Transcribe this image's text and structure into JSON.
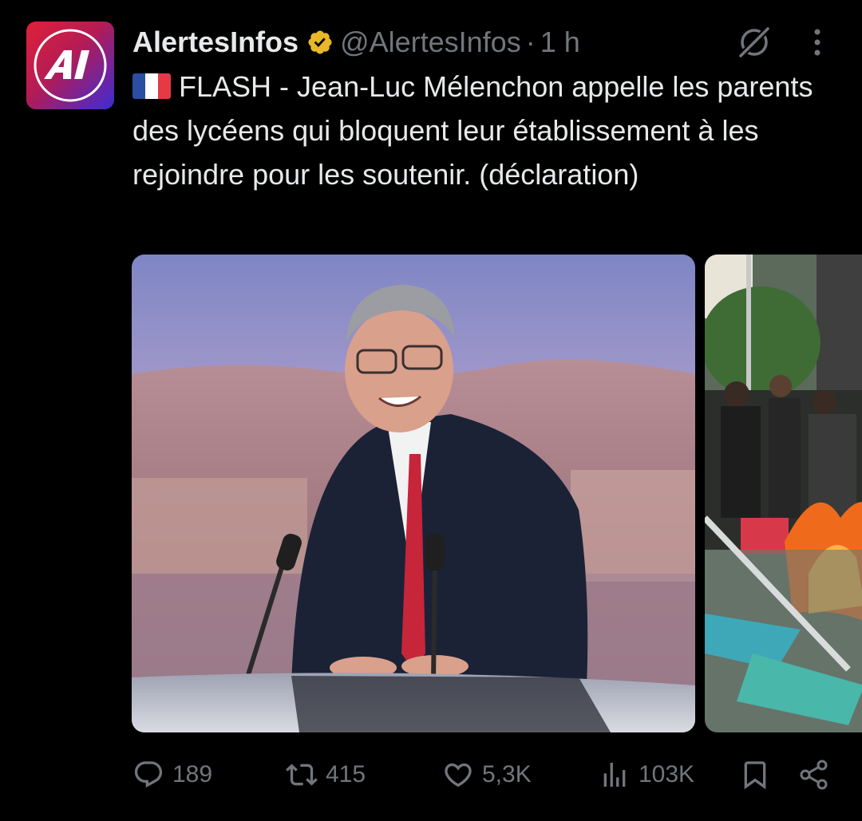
{
  "tweet": {
    "display_name": "AlertesInfos",
    "handle": "@AlertesInfos",
    "separator": "·",
    "time": "1 h",
    "avatar_text": "AI",
    "text": "FLASH - Jean-Luc Mélenchon appelle les parents des lycéens qui bloquent leur établissement à les rejoindre pour les soutenir. (déclaration)",
    "flag_icon": "france-flag-icon",
    "verified_icon": "gold-verified-badge-icon"
  },
  "actions": {
    "replies": "189",
    "reposts": "415",
    "likes": "5,3K",
    "views": "103K"
  },
  "icons": [
    "grok-icon",
    "more-dots-icon",
    "reply-icon",
    "repost-icon",
    "like-icon",
    "views-icon",
    "bookmark-icon",
    "share-icon"
  ],
  "colors": {
    "background": "#000000",
    "text_primary": "#e7e9ea",
    "text_secondary": "#71767b",
    "verified_gold": "#e8b829"
  }
}
